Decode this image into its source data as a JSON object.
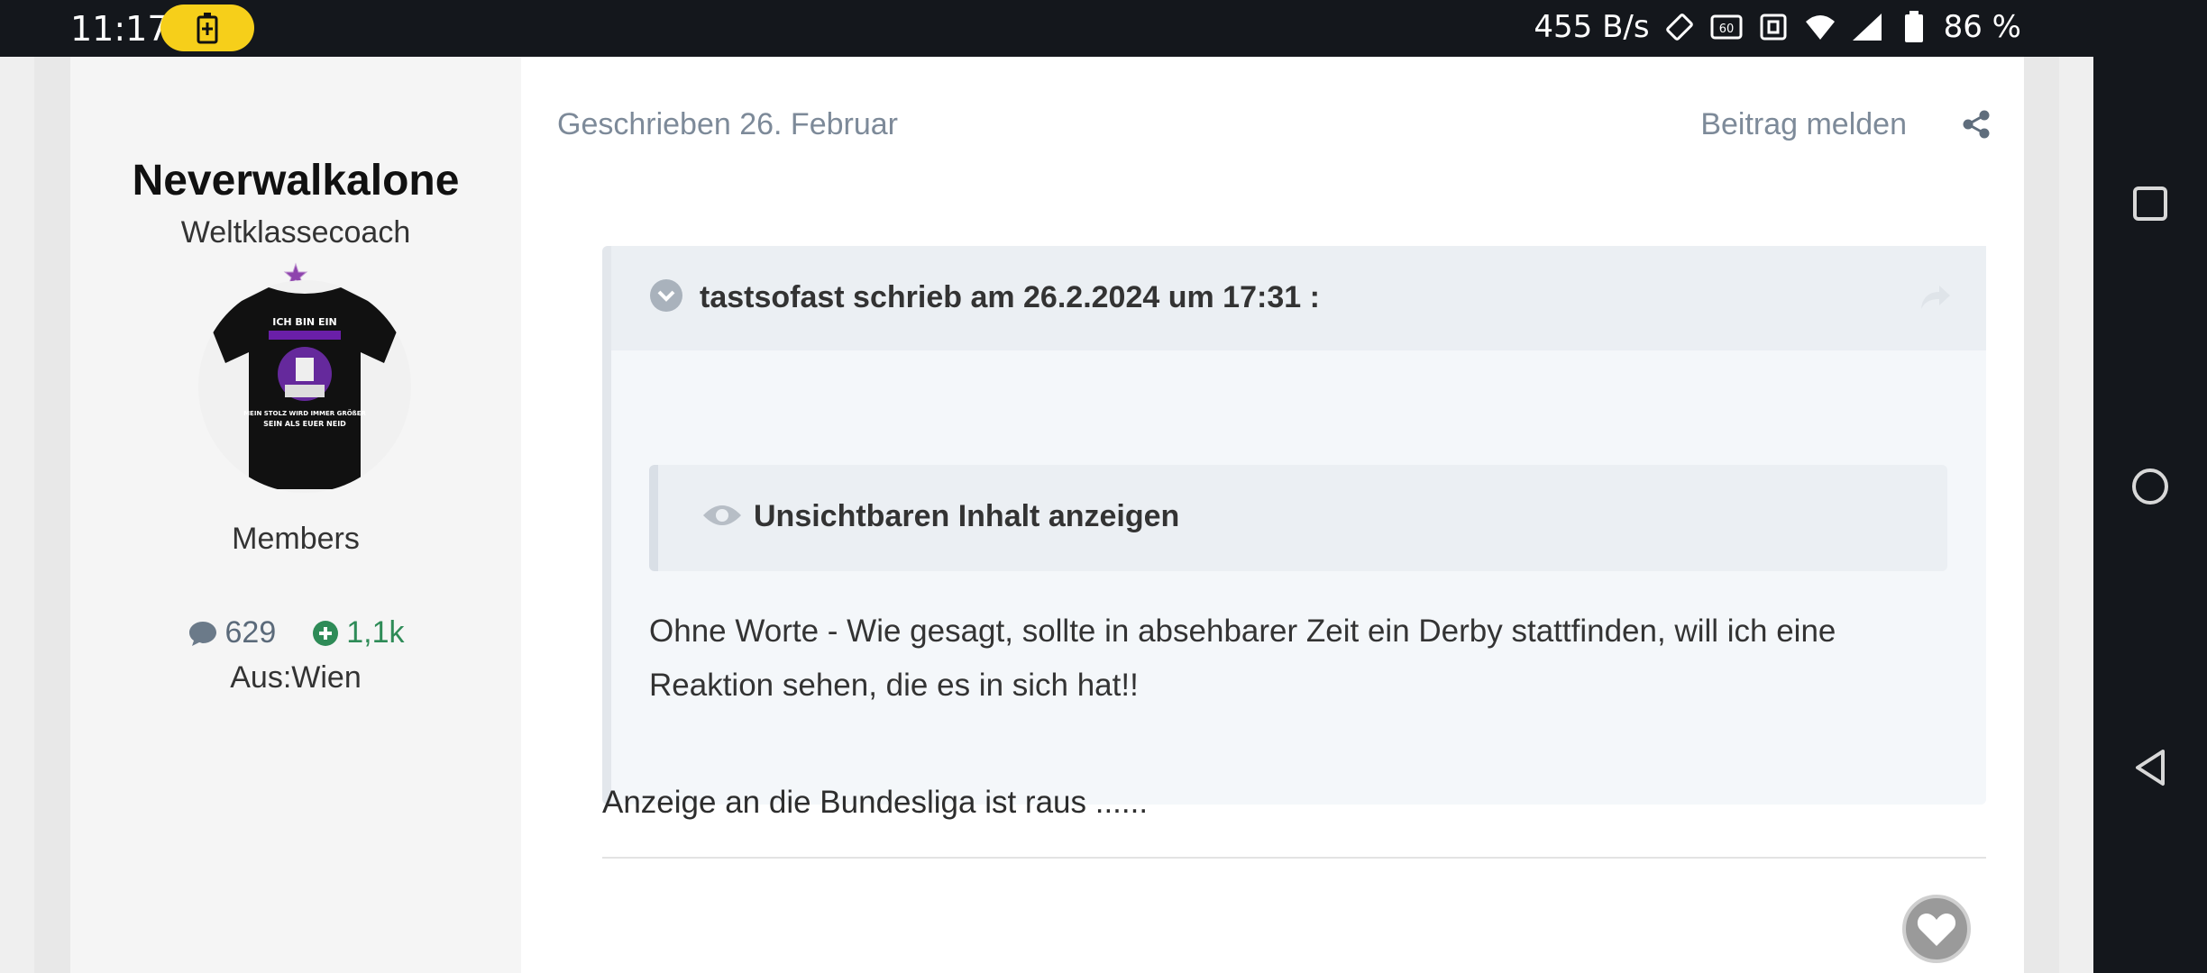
{
  "status_bar": {
    "time": "11:17",
    "net_speed": "455 B/s",
    "battery_percent": "86 %",
    "icons": [
      "battery-saver-icon",
      "rotate-icon",
      "60hz-icon",
      "nfc-icon",
      "wifi-icon",
      "signal-icon",
      "battery-icon"
    ]
  },
  "author": {
    "name": "Neverwalkalone",
    "title": "Weltklassecoach",
    "group": "Members",
    "post_count": "629",
    "reputation": "1,1k",
    "location": "Aus:Wien",
    "avatar_shirt_text": [
      "ICH BIN EIN",
      "MEIN STOLZ WIRD IMMER GRÖßER",
      "SEIN ALS EUER NEID"
    ]
  },
  "post": {
    "date": "Geschrieben 26. Februar",
    "report_label": "Beitrag melden",
    "quote": {
      "citation": "tastsofast schrieb am 26.2.2024 um 17:31 :",
      "hidden_label": "Unsichtbaren Inhalt anzeigen",
      "text": "Ohne Worte - Wie gesagt, sollte in absehbarer Zeit ein Derby stattfinden, will ich eine Reaktion sehen, die es in sich hat!!"
    },
    "body": "Anzeige an die Bundesliga ist raus ......"
  },
  "colors": {
    "muted_text": "#7d8a99",
    "reputation_green": "#2e8b57",
    "status_bar": "#14171c",
    "battery_pill": "#f6cf1a"
  }
}
